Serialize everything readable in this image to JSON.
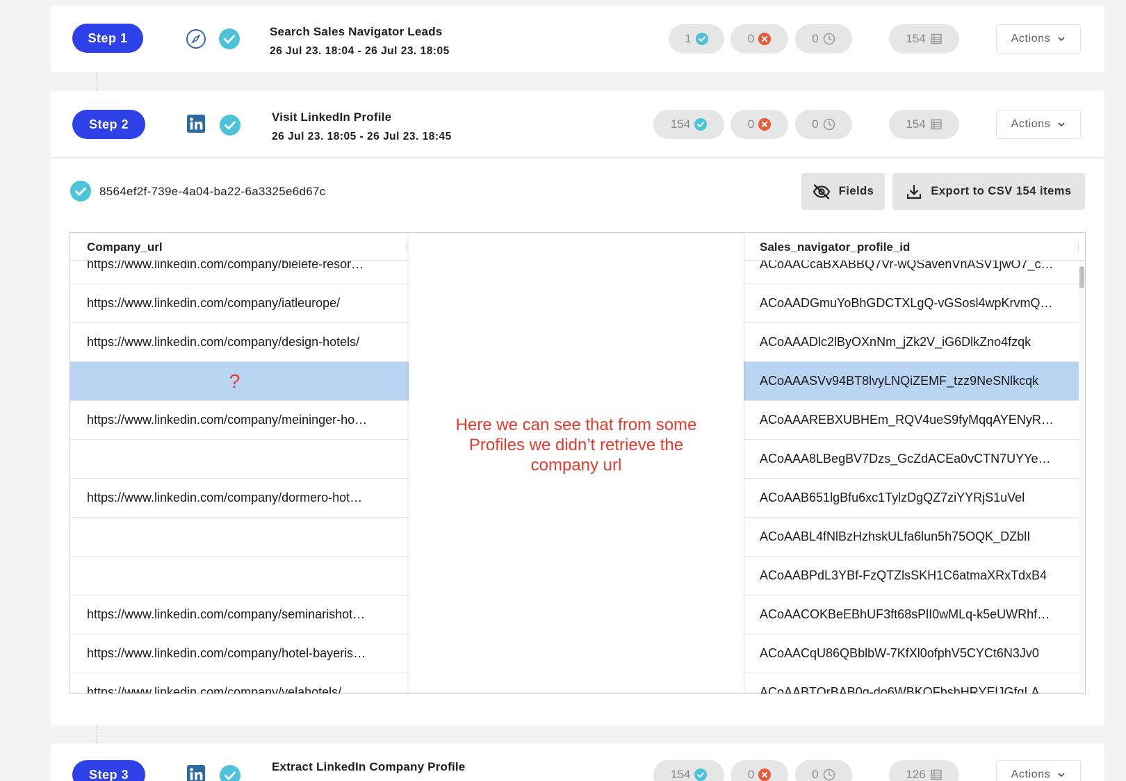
{
  "steps": [
    {
      "label": "Step 1",
      "icon": "compass-icon",
      "title": "Search Sales Navigator Leads",
      "dates": "26 Jul 23. 18:04 - 26 Jul 23. 18:05",
      "success": "1",
      "errors": "0",
      "pending": "0",
      "rows": "154",
      "actions": "Actions"
    },
    {
      "label": "Step 2",
      "icon": "linkedin-icon",
      "title": "Visit LinkedIn Profile",
      "dates": "26 Jul 23. 18:05 - 26 Jul 23. 18:45",
      "success": "154",
      "errors": "0",
      "pending": "0",
      "rows": "154",
      "actions": "Actions"
    },
    {
      "label": "Step 3",
      "icon": "linkedin-icon",
      "title": "Extract LinkedIn Company Profile",
      "success": "154",
      "errors": "0",
      "pending": "0",
      "rows": "126",
      "actions": "Actions"
    }
  ],
  "run": {
    "id": "8564ef2f-739e-4a04-ba22-6a3325e6d67c",
    "fields_label": "Fields",
    "export_label": "Export to CSV 154 items"
  },
  "table": {
    "columns": [
      "Company_url",
      "Sales_navigator_profile_id"
    ],
    "partial_top": [
      "https://www.linkedin.com/company/bielefe-resor…",
      "ACoAACcaBXABBQ7Vr-wQSavenVnASV1jwO7_c…"
    ],
    "rows": [
      [
        "https://www.linkedin.com/company/iatleurope/",
        "ACoAADGmuYoBhGDCTXLgQ-vGSosl4wpKrvmQ…"
      ],
      [
        "https://www.linkedin.com/company/design-hotels/",
        "ACoAAADlc2lByOXnNm_jZk2V_iG6DlkZno4fzqk"
      ],
      [
        "?",
        "ACoAAASVv94BT8lvyLNQiZEMF_tzz9NeSNlkcqk"
      ],
      [
        "https://www.linkedin.com/company/meininger-ho…",
        "ACoAAAREBXUBHEm_RQV4ueS9fyMqqAYENyR…"
      ],
      [
        "",
        "ACoAAA8LBegBV7Dzs_GcZdACEa0vCTN7UYYe…"
      ],
      [
        "https://www.linkedin.com/company/dormero-hot…",
        "ACoAAB651lgBfu6xc1TylzDgQZ7ziYYRjS1uVel"
      ],
      [
        "",
        "ACoAABL4fNlBzHzhskULfa6lun5h75OQK_DZblI"
      ],
      [
        "",
        "ACoAABPdL3YBf-FzQTZlsSKH1C6atmaXRxTdxB4"
      ],
      [
        "https://www.linkedin.com/company/seminarishot…",
        "ACoAACOKBeEBhUF3ft68sPlI0wMLq-k5eUWRhf…"
      ],
      [
        "https://www.linkedin.com/company/hotel-bayeris…",
        "ACoAACqU86QBblbW-7KfXl0ofphV5CYCt6N3Jv0"
      ],
      [
        "https://www.linkedin.com/company/velahotels/",
        "ACoAABTOrBAB0q-do6WBKOFbshHRYElJGfgLA…"
      ]
    ],
    "selected_row": 2
  },
  "annotation": "Here we can see that from some Profiles we didn’t retrieve the company url",
  "colors": {
    "accent": "#2e41e6",
    "success": "#4cc3d8",
    "error": "#e95a38",
    "annotation": "#e43b2d",
    "selection": "#b9d4f3"
  }
}
